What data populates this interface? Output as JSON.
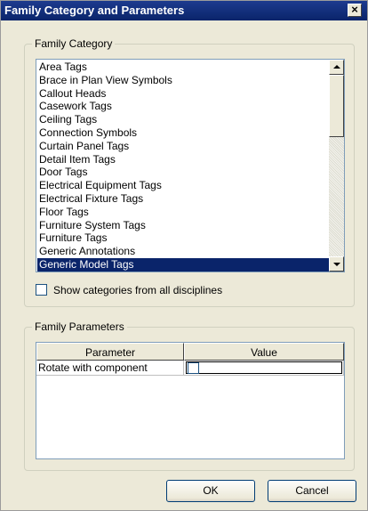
{
  "window": {
    "title": "Family Category and Parameters",
    "close_label": "×"
  },
  "family_category": {
    "label": "Family Category",
    "items": [
      "Area Tags",
      "Brace in Plan View Symbols",
      "Callout Heads",
      "Casework Tags",
      "Ceiling Tags",
      "Connection Symbols",
      "Curtain Panel Tags",
      "Detail Item Tags",
      "Door Tags",
      "Electrical Equipment Tags",
      "Electrical Fixture Tags",
      "Floor Tags",
      "Furniture System Tags",
      "Furniture Tags",
      "Generic Annotations",
      "Generic Model Tags"
    ],
    "selected_index": 15,
    "show_all_label": "Show categories from all disciplines",
    "show_all_checked": false
  },
  "family_parameters": {
    "label": "Family Parameters",
    "columns": [
      "Parameter",
      "Value"
    ],
    "rows": [
      {
        "parameter": "Rotate with component",
        "value_checked": false
      }
    ]
  },
  "buttons": {
    "ok_label": "OK",
    "cancel_label": "Cancel"
  },
  "colors": {
    "title_bar": "#0a246a",
    "dialog_bg": "#ece9d8",
    "selection": "#0a246a"
  }
}
